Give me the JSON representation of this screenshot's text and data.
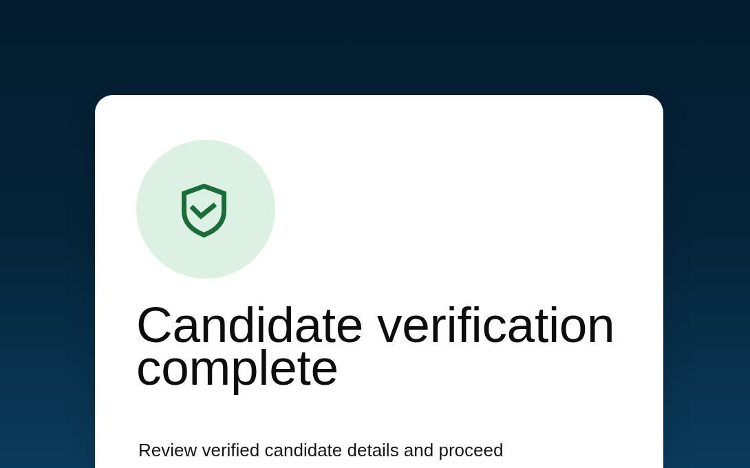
{
  "card": {
    "title": "Candidate verification complete",
    "description": "Review verified candidate details and proceed"
  }
}
